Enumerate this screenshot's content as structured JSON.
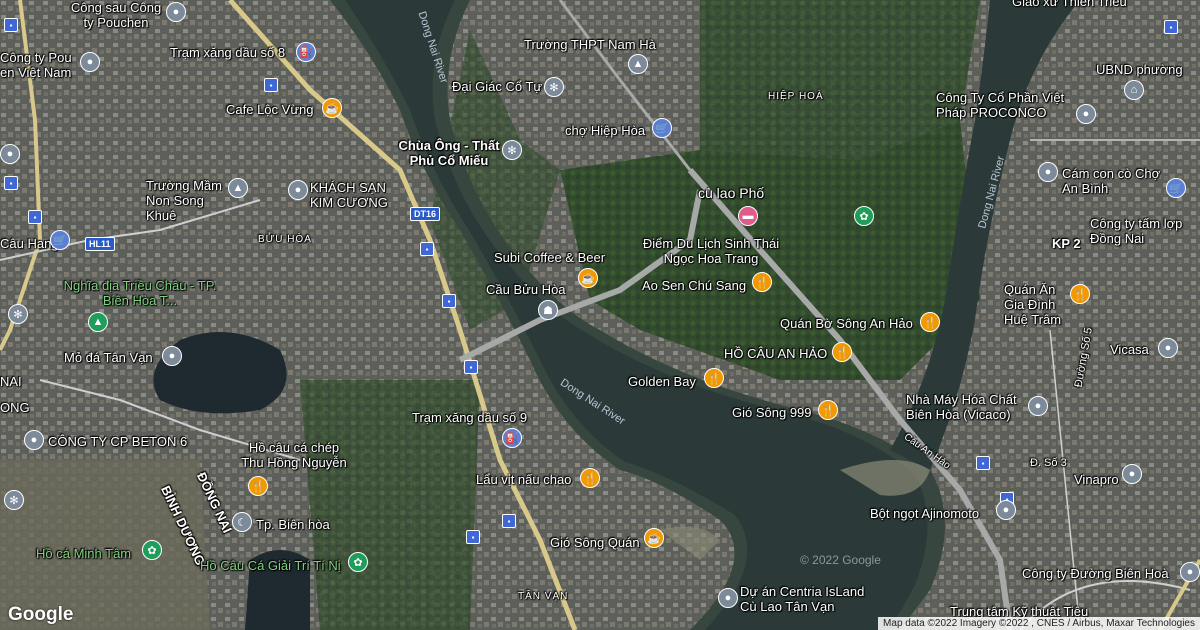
{
  "map": {
    "rivers": [
      "Dong Nai River",
      "Dong Nai River",
      "Dong Nai River"
    ],
    "roads": [
      "DT16",
      "HL11",
      "Cầu An Hảo"
    ],
    "areas": [
      "HIỆP HOÀ",
      "BỬU HÒA",
      "TÂN VẠN",
      "ĐỒNG NAI",
      "BÌNH DƯƠNG",
      "KP 2",
      "NAI",
      "ONG"
    ],
    "places": [
      {
        "label": "Công sau Công ty Pouchen",
        "icon": "grey"
      },
      {
        "label": "Công ty Pou en Việt Nam",
        "icon": "grey"
      },
      {
        "label": "Trạm xăng dầu số 8",
        "icon": "blue"
      },
      {
        "label": "Cafe Lộc Vừng",
        "icon": "orange"
      },
      {
        "label": "Trường THPT Nam Hà",
        "icon": "grey"
      },
      {
        "label": "Đại Giác Cổ Tự",
        "icon": "grey"
      },
      {
        "label": "chợ Hiệp Hòa",
        "icon": "blue"
      },
      {
        "label": "Chùa Ông - Thất Phủ Cổ Miếu",
        "icon": "grey"
      },
      {
        "label": "Trường Mầm Non Song Khuê",
        "icon": "grey"
      },
      {
        "label": "KHÁCH SẠN KIM CƯƠNG",
        "icon": "grey"
      },
      {
        "label": "cù lao Phố",
        "icon": "pink"
      },
      {
        "label": "Điểm Du Lịch Sinh Thái Ngọc Hoa Trang",
        "icon": "orange"
      },
      {
        "label": "Subi Coffee & Beer",
        "icon": "orange"
      },
      {
        "label": "Ao Sen Chú Sang",
        "icon": "orange"
      },
      {
        "label": "Cầu Bửu Hòa",
        "icon": "grey"
      },
      {
        "label": "Nghĩa địa Triều Châu - TP. Biên Hòa T...",
        "icon": "green"
      },
      {
        "label": "Mỏ đá Tân Vạn",
        "icon": "grey"
      },
      {
        "label": "Quán Bờ Sông An Hảo",
        "icon": "orange"
      },
      {
        "label": "HỒ CÂU AN HẢO",
        "icon": "orange"
      },
      {
        "label": "Golden Bay",
        "icon": "orange"
      },
      {
        "label": "Gió Sông 999",
        "icon": "orange"
      },
      {
        "label": "Trạm xăng dầu số 9",
        "icon": "blue"
      },
      {
        "label": "CÔNG TY CP BETON 6",
        "icon": "grey"
      },
      {
        "label": "Hồ câu cá chép Thu Hồng Nguyễn",
        "icon": "orange"
      },
      {
        "label": "Lẩu vịt nấu chao",
        "icon": "orange"
      },
      {
        "label": "Tp. Biên hòa",
        "icon": "grey"
      },
      {
        "label": "Gió Sông Quán",
        "icon": "orange"
      },
      {
        "label": "Hồ cá Minh Tâm",
        "icon": "green"
      },
      {
        "label": "Hồ Câu Cá Giải Trí Tí Nị",
        "icon": "green"
      },
      {
        "label": "Dự án Centria IsLand Cù Lao Tân Vạn",
        "icon": "grey"
      },
      {
        "label": "Giáo xứ Thiên Triều",
        "icon": "grey"
      },
      {
        "label": "UBND phường",
        "icon": "grey"
      },
      {
        "label": "Công Ty Cổ Phần Việt Pháp PROCONCO",
        "icon": "grey"
      },
      {
        "label": "Cám con cò Chợ An Bình",
        "icon": "blue"
      },
      {
        "label": "Công ty tấm lợp Đồng Nai",
        "icon": "grey"
      },
      {
        "label": "Quán Ăn Gia Đình Huệ Trâm",
        "icon": "orange"
      },
      {
        "label": "Vicasa",
        "icon": "grey"
      },
      {
        "label": "Nhà Máy Hóa Chất Biên Hòa (Vicaco)",
        "icon": "grey"
      },
      {
        "label": "Vinapro",
        "icon": "grey"
      },
      {
        "label": "Bột ngọt Ajinomoto",
        "icon": "grey"
      },
      {
        "label": "Công ty Đường Biên Hoà",
        "icon": "grey"
      },
      {
        "label": "Trung tâm Kỹ thuật Tiêu",
        "icon": "grey"
      },
      {
        "label": "Đường Số 5",
        "icon": ""
      },
      {
        "label": "Đ. Số 3",
        "icon": ""
      },
      {
        "label": "Câu Hang",
        "icon": ""
      }
    ]
  },
  "branding": {
    "logo": "Google"
  },
  "watermark": "© 2022 Google",
  "attribution": "Map data ©2022 Imagery ©2022 , CNES / Airbus, Maxar Technologies"
}
